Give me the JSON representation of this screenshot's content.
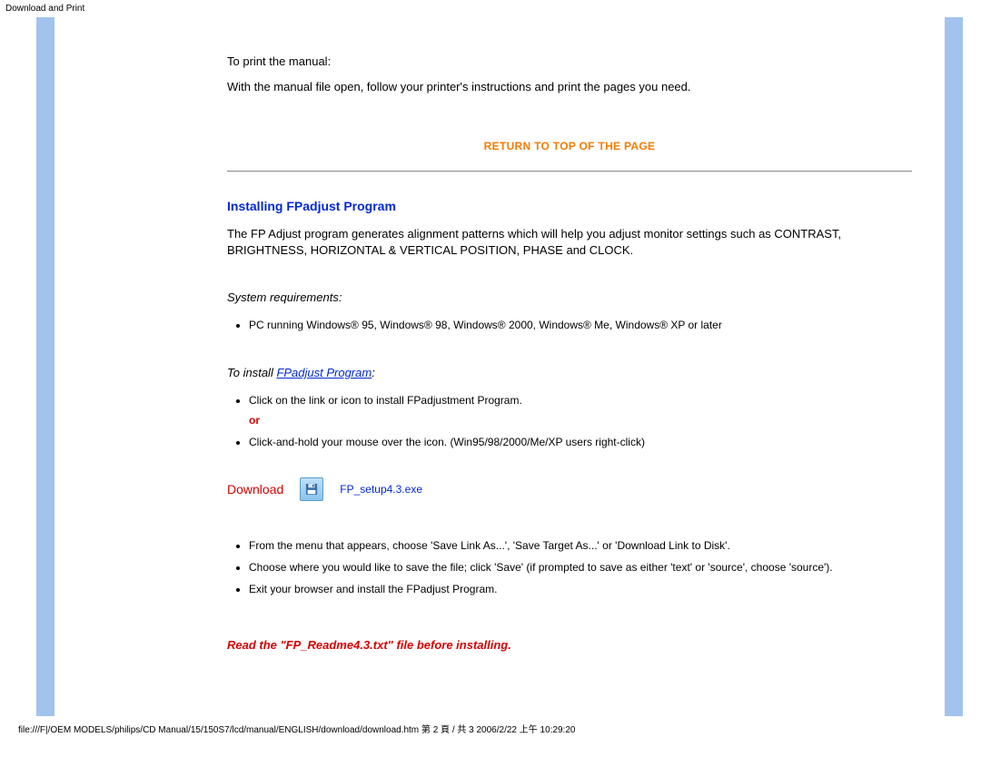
{
  "header": {
    "breadcrumb": "Download and Print"
  },
  "manual": {
    "print_heading": "To print the manual:",
    "print_instructions": "With the manual file open, follow your printer's instructions and print the pages you need."
  },
  "return_top": "RETURN TO TOP OF THE PAGE",
  "fpadjust": {
    "title": "Installing FPadjust Program",
    "desc": "The FP Adjust program generates alignment patterns which will help you adjust monitor settings such as CONTRAST, BRIGHTNESS, HORIZONTAL & VERTICAL POSITION, PHASE and CLOCK.",
    "sysreq_label": "System requirements:",
    "sysreq_item": "PC running Windows® 95, Windows® 98, Windows® 2000, Windows® Me, Windows® XP or later",
    "install_label_prefix": "To install ",
    "install_label_link": "FPadjust Program",
    "install_label_suffix": ":",
    "install_step1": "Click on the link or icon to install FPadjustment Program.",
    "or": "or",
    "install_step2": "Click-and-hold your mouse over the icon. (Win95/98/2000/Me/XP users right-click)",
    "download_label": "Download",
    "download_file": "FP_setup4.3.exe",
    "menu_step1": "From the menu that appears, choose 'Save Link As...', 'Save Target As...' or 'Download Link to Disk'.",
    "menu_step2": "Choose where you would like to save the file; click 'Save' (if prompted to save as either 'text' or 'source', choose 'source').",
    "menu_step3": "Exit your browser and install the FPadjust Program.",
    "readme_notice": "Read the \"FP_Readme4.3.txt\" file before installing."
  },
  "footer": {
    "path": "file:///F|/OEM MODELS/philips/CD Manual/15/150S7/lcd/manual/ENGLISH/download/download.htm 第 2 頁 / 共 3 2006/2/22 上午 10:29:20"
  }
}
